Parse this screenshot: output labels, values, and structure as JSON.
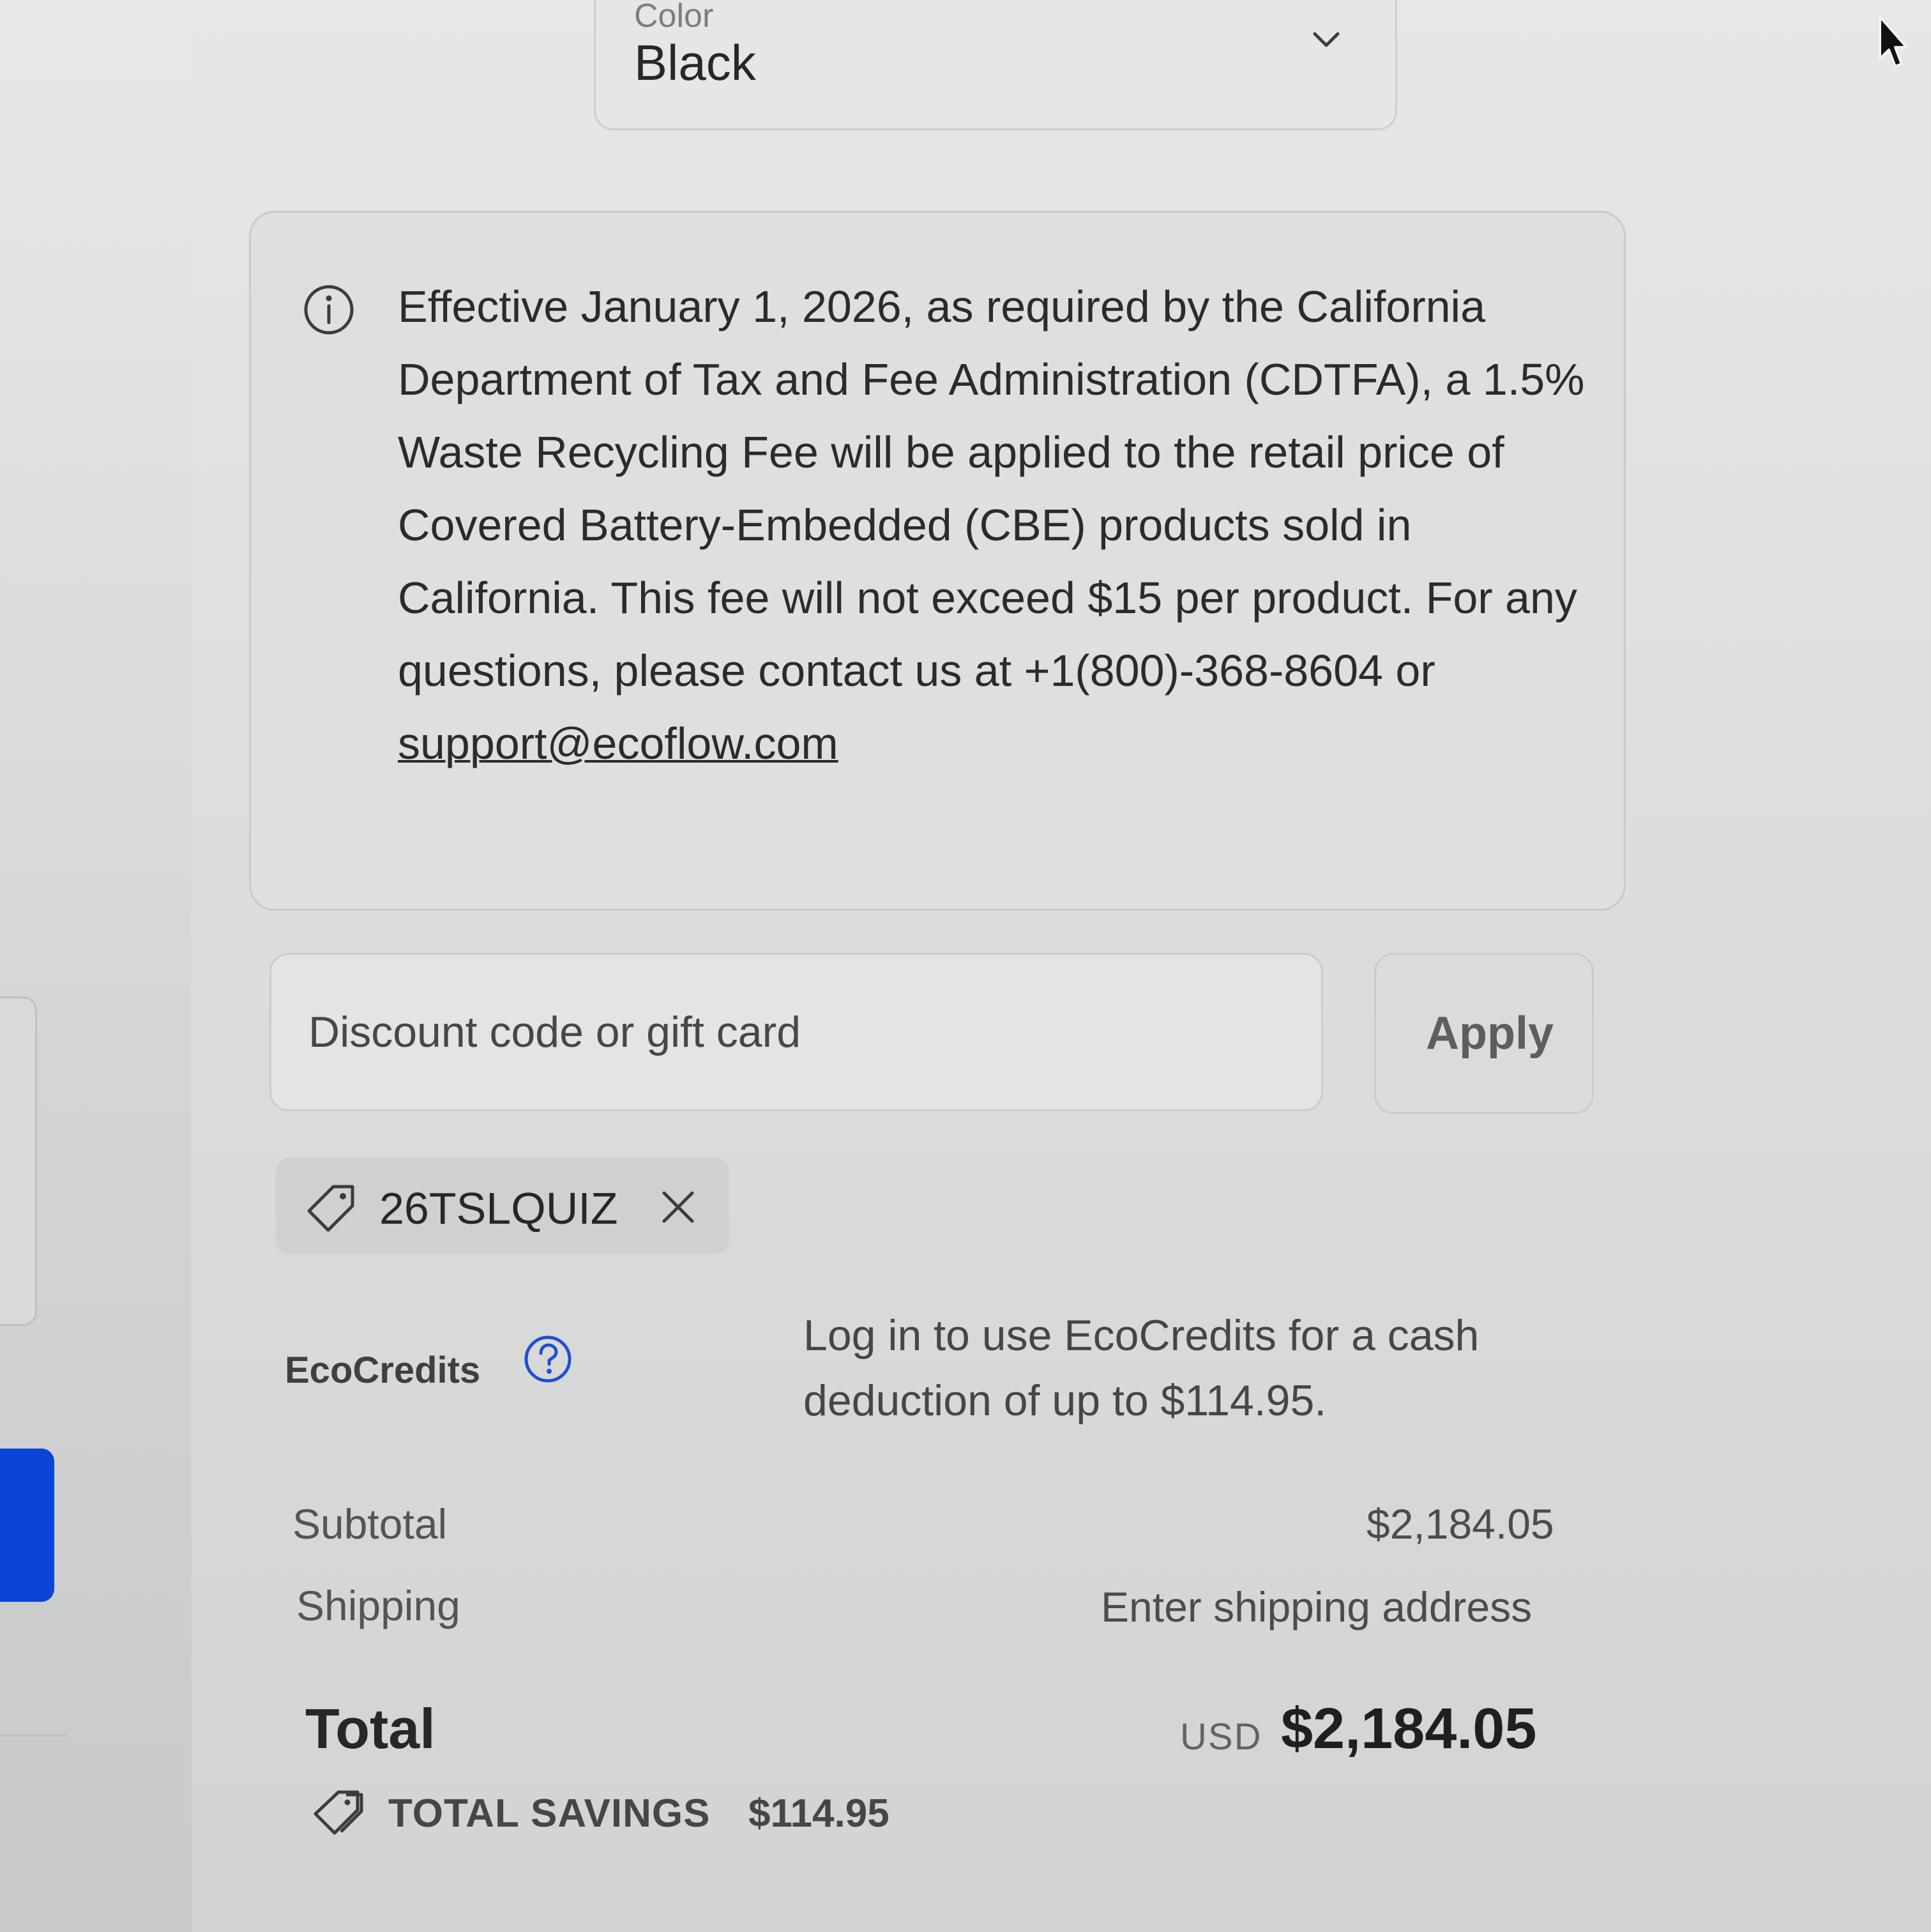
{
  "product_option": {
    "label": "Color",
    "value": "Black"
  },
  "notice": {
    "text": "Effective January 1, 2026, as required by the California Department of Tax and Fee Administration (CDTFA), a 1.5% Waste Recycling Fee will be applied to the retail price of Covered Battery-Embedded (CBE) products sold in California. This fee will not exceed $15 per product. For any questions, please contact us at +1(800)-368-8604 or",
    "email": "support@ecoflow.com",
    "icon": "info-icon"
  },
  "discount": {
    "placeholder": "Discount code or gift card",
    "apply_label": "Apply"
  },
  "coupon": {
    "code": "26TSLQUIZ",
    "icon": "tag-icon",
    "remove_icon": "close-icon"
  },
  "ecocredits": {
    "label": "EcoCredits",
    "help_icon": "question-circle-icon",
    "text": "Log in to use EcoCredits for a cash deduction of up to $114.95."
  },
  "summary": {
    "subtotal_label": "Subtotal",
    "subtotal_value": "$2,184.05",
    "shipping_label": "Shipping",
    "shipping_value": "Enter shipping address",
    "total_label": "Total",
    "currency": "USD",
    "total_value": "$2,184.05",
    "savings_label": "TOTAL SAVINGS",
    "savings_value": "$114.95",
    "savings_icon": "savings-tag-icon"
  },
  "colors": {
    "accent_blue": "#0d44d8",
    "help_icon_blue": "#1f4fd1"
  }
}
